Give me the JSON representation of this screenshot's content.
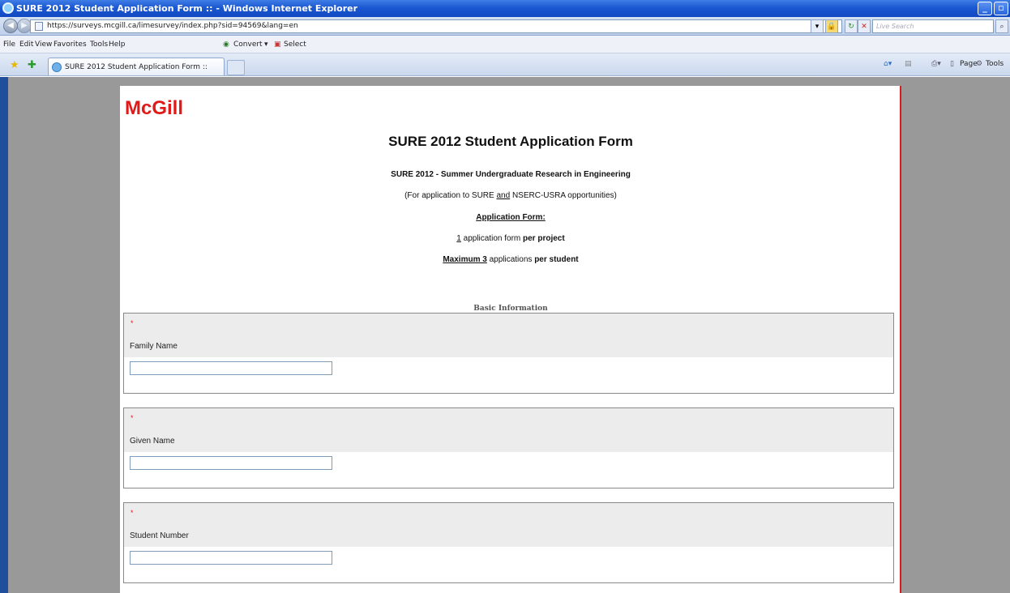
{
  "window": {
    "title": "SURE 2012 Student Application Form :: - Windows Internet Explorer"
  },
  "addressbar": {
    "url": "https://surveys.mcgill.ca/limesurvey/index.php?sid=94569&lang=en",
    "live_search_placeholder": "Live Search"
  },
  "menubar": {
    "items": [
      "File",
      "Edit",
      "View",
      "Favorites",
      "Tools",
      "Help"
    ],
    "convert_label": "Convert",
    "select_label": "Select"
  },
  "tabs": {
    "active_tab_title": "SURE 2012 Student Application Form ::",
    "page_label": "Page",
    "tools_label": "Tools"
  },
  "page": {
    "logo": "McGill",
    "form_title": "SURE 2012 Student Application Form",
    "subtitle": "SURE 2012 - Summer Undergraduate Research in Engineering",
    "app_note_prefix": "(For application to SURE ",
    "app_note_and": "and",
    "app_note_suffix": " NSERC-USRA opportunities)",
    "application_form_heading": "Application Form:",
    "per_project_count": "1",
    "per_project_mid": " application form ",
    "per_project_bold": "per project",
    "max_apps_underline": "Maximum 3",
    "max_apps_mid": " applications ",
    "max_apps_bold": "per student",
    "section_title": "Basic Information"
  },
  "questions": [
    {
      "required_marker": "*",
      "label": "Family Name",
      "value": ""
    },
    {
      "required_marker": "*",
      "label": "Given Name",
      "value": ""
    },
    {
      "required_marker": "*",
      "label": "Student Number",
      "value": ""
    }
  ]
}
